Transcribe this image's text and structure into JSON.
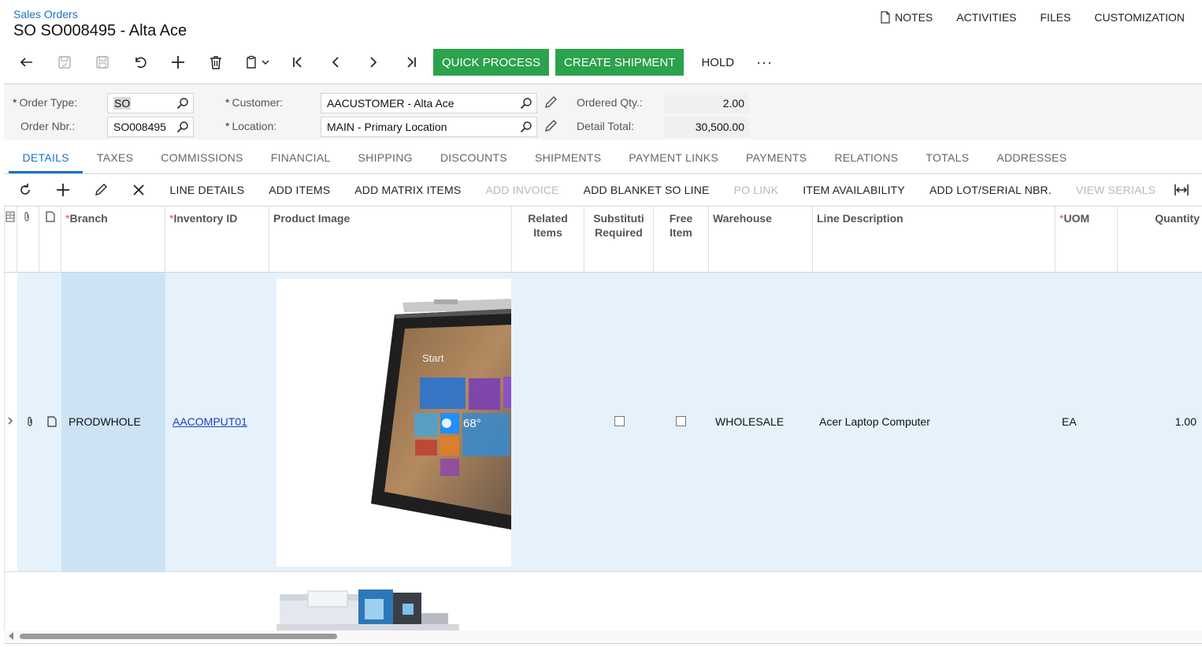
{
  "header": {
    "breadcrumb": "Sales Orders",
    "title": "SO SO008495 - Alta Ace",
    "links": [
      "NOTES",
      "ACTIVITIES",
      "FILES",
      "CUSTOMIZATION"
    ]
  },
  "toolbar": {
    "quick_process": "QUICK PROCESS",
    "create_shipment": "CREATE SHIPMENT",
    "hold": "HOLD",
    "more": "···",
    "accent": "#2ba24c"
  },
  "form": {
    "order_type_label": "Order Type:",
    "order_type_value": "SO",
    "order_nbr_label": "Order Nbr.:",
    "order_nbr_value": "SO008495",
    "customer_label": "Customer:",
    "customer_value": "AACUSTOMER - Alta Ace",
    "location_label": "Location:",
    "location_value": "MAIN - Primary Location",
    "ordered_qty_label": "Ordered Qty.:",
    "ordered_qty_value": "2.00",
    "detail_total_label": "Detail Total:",
    "detail_total_value": "30,500.00",
    "required_mark": "*"
  },
  "tabs": [
    "DETAILS",
    "TAXES",
    "COMMISSIONS",
    "FINANCIAL",
    "SHIPPING",
    "DISCOUNTS",
    "SHIPMENTS",
    "PAYMENT LINKS",
    "PAYMENTS",
    "RELATIONS",
    "TOTALS",
    "ADDRESSES"
  ],
  "grid_toolbar": {
    "buttons": [
      "LINE DETAILS",
      "ADD ITEMS",
      "ADD MATRIX ITEMS",
      "ADD INVOICE",
      "ADD BLANKET SO LINE",
      "PO LINK",
      "ITEM AVAILABILITY",
      "ADD LOT/SERIAL NBR.",
      "VIEW SERIALS"
    ]
  },
  "grid": {
    "columns": {
      "branch": "Branch",
      "inventory_id": "Inventory ID",
      "product_image": "Product Image",
      "related_items_1": "Related",
      "related_items_2": "Items",
      "substitution_1": "Substituti",
      "substitution_2": "Required",
      "free_item_1": "Free",
      "free_item_2": "Item",
      "warehouse": "Warehouse",
      "line_description": "Line Description",
      "uom": "UOM",
      "quantity": "Quantity",
      "star": "*"
    },
    "row": {
      "branch": "PRODWHOLE",
      "inventory_id": "AACOMPUT01",
      "warehouse": "WHOLESALE",
      "line_description": "Acer Laptop Computer",
      "uom": "EA",
      "quantity": "1.00"
    },
    "tablet_tiles": [
      "Start",
      "68°"
    ]
  }
}
